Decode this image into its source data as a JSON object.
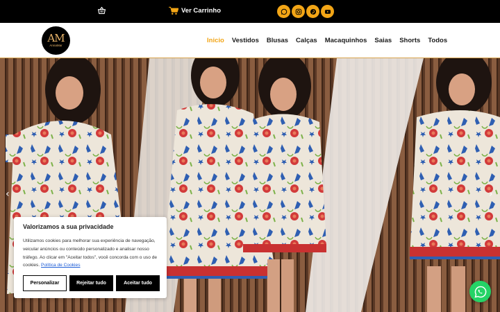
{
  "topbar": {
    "cart_label": "Ver Carrinho",
    "icons": [
      "basket-icon",
      "cart-icon"
    ],
    "socials": [
      "whatsapp-icon",
      "instagram-icon",
      "pinterest-icon",
      "youtube-icon"
    ],
    "accent": "#f2a516"
  },
  "header": {
    "logo_mono": "AM",
    "logo_text": "AnnaMar",
    "nav": [
      {
        "label": "Inicio",
        "active": true
      },
      {
        "label": "Vestidos",
        "active": false
      },
      {
        "label": "Blusas",
        "active": false
      },
      {
        "label": "Calças",
        "active": false
      },
      {
        "label": "Macaquinhos",
        "active": false
      },
      {
        "label": "Saias",
        "active": false
      },
      {
        "label": "Shorts",
        "active": false
      },
      {
        "label": "Todos",
        "active": false
      }
    ]
  },
  "hero": {
    "prev_arrow": "‹",
    "next_arrow": "›"
  },
  "cookie": {
    "title": "Valorizamos a sua privacidade",
    "text": "Utilizamos cookies para melhorar sua experiência de navegação, veicular anúncios ou conteúdo personalizado e analisar nosso tráfego. Ao clicar em \"Aceitar todos\", você concorda com o uso de cookies.",
    "policy_link": "Política de Cookies",
    "customize": "Personalizar",
    "reject": "Rejeitar tudo",
    "accept": "Aceitar tudo"
  },
  "colors": {
    "brand": "#f2a516",
    "whatsapp": "#25d366",
    "link": "#1a5bd6"
  }
}
